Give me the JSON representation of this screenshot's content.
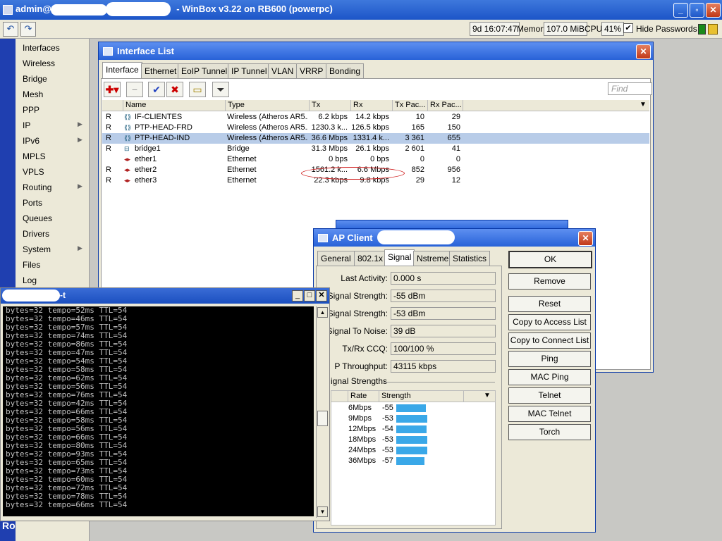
{
  "app": {
    "title": "admin@ - WinBox v3.22 on RB600 (powerpc)",
    "title_prefix": "admin@",
    "title_suffix": "- WinBox v3.22 on RB600 (powerpc)"
  },
  "toolbar": {
    "uptime": "9d 16:07:47",
    "memory_label": "Memory:",
    "memory_value": "107.0 MiB",
    "cpu_label": "CPU:",
    "cpu_value": "41%",
    "hide_passwords_label": "Hide Passwords",
    "hide_passwords_checked": true
  },
  "sidebar": {
    "vertical_label": "Ro",
    "items": [
      {
        "label": "Interfaces",
        "submenu": false
      },
      {
        "label": "Wireless",
        "submenu": false
      },
      {
        "label": "Bridge",
        "submenu": false
      },
      {
        "label": "Mesh",
        "submenu": false
      },
      {
        "label": "PPP",
        "submenu": false
      },
      {
        "label": "IP",
        "submenu": true
      },
      {
        "label": "IPv6",
        "submenu": true
      },
      {
        "label": "MPLS",
        "submenu": false
      },
      {
        "label": "VPLS",
        "submenu": false
      },
      {
        "label": "Routing",
        "submenu": true
      },
      {
        "label": "Ports",
        "submenu": false
      },
      {
        "label": "Queues",
        "submenu": false
      },
      {
        "label": "Drivers",
        "submenu": false
      },
      {
        "label": "System",
        "submenu": true
      },
      {
        "label": "Files",
        "submenu": false
      },
      {
        "label": "Log",
        "submenu": false
      }
    ]
  },
  "interface_list": {
    "title": "Interface List",
    "tabs": [
      "Interface",
      "Ethernet",
      "EoIP Tunnel",
      "IP Tunnel",
      "VLAN",
      "VRRP",
      "Bonding"
    ],
    "active_tab": "Interface",
    "find_placeholder": "Find",
    "columns": [
      "Name",
      "Type",
      "Tx",
      "Rx",
      "Tx Pac...",
      "Rx Pac..."
    ],
    "rows": [
      {
        "flag": "R",
        "icon": "wireless-icon",
        "name": "IF-CLIENTES",
        "type": "Wireless (Atheros AR5...",
        "tx": "6.2 kbps",
        "rx": "14.2 kbps",
        "txp": "10",
        "rxp": "29",
        "selected": false
      },
      {
        "flag": "R",
        "icon": "wireless-icon",
        "name": "PTP-HEAD-FRD",
        "type": "Wireless (Atheros AR5...",
        "tx": "1230.3 k...",
        "rx": "126.5 kbps",
        "txp": "165",
        "rxp": "150",
        "selected": false
      },
      {
        "flag": "R",
        "icon": "wireless-icon",
        "name": "PTP-HEAD-IND",
        "type": "Wireless (Atheros AR5...",
        "tx": "36.6 Mbps",
        "rx": "1331.4 k...",
        "txp": "3 361",
        "rxp": "655",
        "selected": true
      },
      {
        "flag": "R",
        "icon": "bridge-icon",
        "name": "bridge1",
        "type": "Bridge",
        "tx": "31.3 Mbps",
        "rx": "26.1 kbps",
        "txp": "2 601",
        "rxp": "41",
        "selected": false
      },
      {
        "flag": "",
        "icon": "ethernet-icon",
        "name": "ether1",
        "type": "Ethernet",
        "tx": "0 bps",
        "rx": "0 bps",
        "txp": "0",
        "rxp": "0",
        "selected": false
      },
      {
        "flag": "R",
        "icon": "ethernet-icon",
        "name": "ether2",
        "type": "Ethernet",
        "tx": "1561.2 k...",
        "rx": "6.6 Mbps",
        "txp": "852",
        "rxp": "956",
        "selected": false
      },
      {
        "flag": "R",
        "icon": "ethernet-icon",
        "name": "ether3",
        "type": "Ethernet",
        "tx": "22.3 kbps",
        "rx": "9.8 kbps",
        "txp": "29",
        "rxp": "12",
        "selected": false
      }
    ]
  },
  "ap_client": {
    "title": "AP Client",
    "tabs": [
      "General",
      "802.1x",
      "Signal",
      "Nstreme",
      "Statistics"
    ],
    "active_tab": "Signal",
    "fields": [
      {
        "label": "Last Activity:",
        "value": "0.000 s"
      },
      {
        "label": "Signal Strength:",
        "value": "-55 dBm"
      },
      {
        "label": "Signal Strength:",
        "value": "-53 dBm"
      },
      {
        "label": "Signal To Noise:",
        "value": "39 dB"
      },
      {
        "label": "Tx/Rx CCQ:",
        "value": "100/100 %"
      },
      {
        "label": "P Throughput:",
        "value": "43115 kbps"
      }
    ],
    "strengths_title": "ignal Strengths",
    "strength_columns": [
      "Rate",
      "Strength"
    ],
    "strengths": [
      {
        "rate": "6Mbps",
        "value": "-55",
        "level": 0.8
      },
      {
        "rate": "9Mbps",
        "value": "-53",
        "level": 0.84
      },
      {
        "rate": "12Mbps",
        "value": "-54",
        "level": 0.82
      },
      {
        "rate": "18Mbps",
        "value": "-53",
        "level": 0.84
      },
      {
        "rate": "24Mbps",
        "value": "-53",
        "level": 0.84
      },
      {
        "rate": "36Mbps",
        "value": "-57",
        "level": 0.76
      }
    ],
    "buttons": [
      "OK",
      "Remove",
      "Reset",
      "Copy to Access List",
      "Copy to Connect List",
      "Ping",
      "MAC Ping",
      "Telnet",
      "MAC Telnet",
      "Torch"
    ]
  },
  "terminal": {
    "title": "-t",
    "lines": [
      "bytes=32 tempo=52ms TTL=54",
      "bytes=32 tempo=46ms TTL=54",
      "bytes=32 tempo=57ms TTL=54",
      "bytes=32 tempo=74ms TTL=54",
      "bytes=32 tempo=86ms TTL=54",
      "bytes=32 tempo=47ms TTL=54",
      "bytes=32 tempo=54ms TTL=54",
      "bytes=32 tempo=58ms TTL=54",
      "bytes=32 tempo=62ms TTL=54",
      "bytes=32 tempo=56ms TTL=54",
      "bytes=32 tempo=76ms TTL=54",
      "bytes=32 tempo=42ms TTL=54",
      "bytes=32 tempo=66ms TTL=54",
      "bytes=32 tempo=58ms TTL=54",
      "bytes=32 tempo=56ms TTL=54",
      "bytes=32 tempo=66ms TTL=54",
      "bytes=32 tempo=80ms TTL=54",
      "bytes=32 tempo=93ms TTL=54",
      "bytes=32 tempo=65ms TTL=54",
      "bytes=32 tempo=73ms TTL=54",
      "bytes=32 tempo=60ms TTL=54",
      "bytes=32 tempo=72ms TTL=54",
      "bytes=32 tempo=78ms TTL=54",
      "bytes=32 tempo=66ms TTL=54"
    ]
  }
}
